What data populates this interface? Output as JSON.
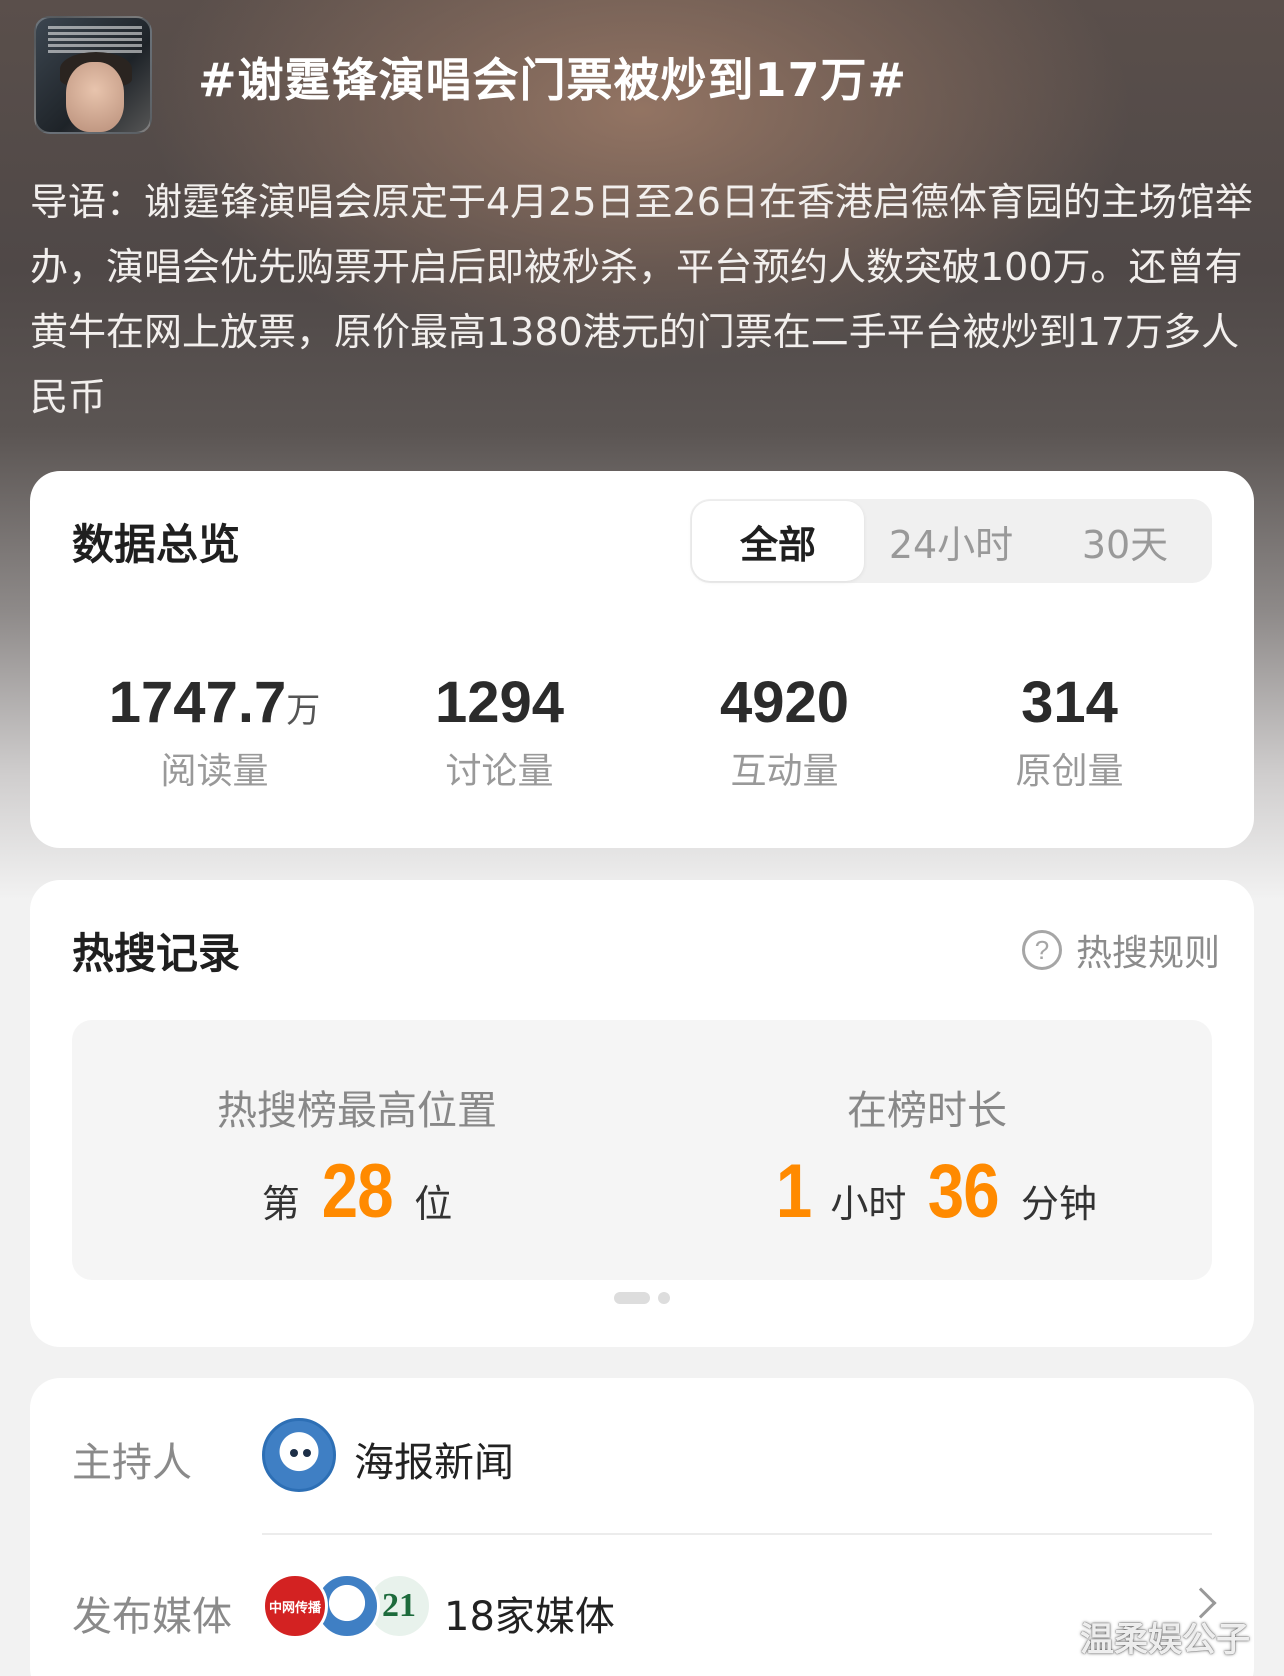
{
  "header": {
    "title": "#谢霆锋演唱会门票被炒到17万#",
    "intro": "导语：谢霆锋演唱会原定于4月25日至26日在香港启德体育园的主场馆举办，演唱会优先购票开启后即被秒杀，平台预约人数突破100万。还曾有黄牛在网上放票，原价最高1380港元的门票在二手平台被炒到17万多人民币"
  },
  "overview": {
    "title": "数据总览",
    "tabs": [
      "全部",
      "24小时",
      "30天"
    ],
    "active_tab": "全部",
    "stats": [
      {
        "value": "1747.7",
        "unit": "万",
        "label": "阅读量"
      },
      {
        "value": "1294",
        "unit": "",
        "label": "讨论量"
      },
      {
        "value": "4920",
        "unit": "",
        "label": "互动量"
      },
      {
        "value": "314",
        "unit": "",
        "label": "原创量"
      }
    ]
  },
  "hot_search": {
    "title": "热搜记录",
    "rules_label": "热搜规则",
    "peak": {
      "label": "热搜榜最高位置",
      "prefix": "第",
      "value": "28",
      "suffix": "位"
    },
    "duration": {
      "label": "在榜时长",
      "hours": "1",
      "hours_unit": "小时",
      "minutes": "36",
      "minutes_unit": "分钟"
    }
  },
  "info": {
    "host_label": "主持人",
    "host_name": "海报新闻",
    "media_label": "发布媒体",
    "media_logo_text": [
      "中网传播",
      "21"
    ],
    "media_count": "18家媒体"
  },
  "watermark": "温柔娱公子",
  "colors": {
    "accent": "#ff8a00",
    "card": "#ffffff",
    "background": "#f2f2f2"
  }
}
